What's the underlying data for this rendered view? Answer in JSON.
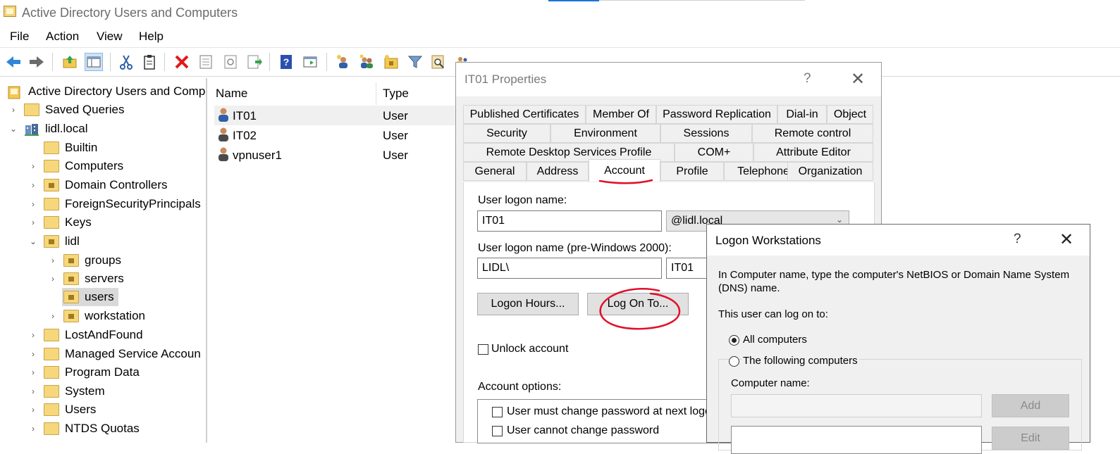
{
  "window": {
    "title": "Active Directory Users and Computers"
  },
  "menu": [
    "File",
    "Action",
    "View",
    "Help"
  ],
  "toolbar": {
    "icons": [
      "back-arrow-icon",
      "forward-arrow-icon",
      "up-folder-icon",
      "console-tree-icon",
      "cut-icon",
      "clipboard-icon",
      "delete-icon",
      "properties-icon",
      "refresh-icon",
      "export-list-icon",
      "help-icon",
      "action-pane-icon",
      "new-user-icon",
      "new-group-icon",
      "new-ou-icon",
      "filter-icon",
      "find-icon",
      "add-to-group-icon"
    ]
  },
  "tree": {
    "root": "Active Directory Users and Comp",
    "items": [
      {
        "label": "Saved Queries"
      },
      {
        "label": "lidl.local"
      },
      {
        "label": "Builtin"
      },
      {
        "label": "Computers"
      },
      {
        "label": "Domain Controllers"
      },
      {
        "label": "ForeignSecurityPrincipals"
      },
      {
        "label": "Keys"
      },
      {
        "label": "lidl"
      },
      {
        "label": "groups"
      },
      {
        "label": "servers"
      },
      {
        "label": "users"
      },
      {
        "label": "workstation"
      },
      {
        "label": "LostAndFound"
      },
      {
        "label": "Managed Service Accoun"
      },
      {
        "label": "Program Data"
      },
      {
        "label": "System"
      },
      {
        "label": "Users"
      },
      {
        "label": "NTDS Quotas"
      }
    ]
  },
  "list": {
    "columns": [
      "Name",
      "Type"
    ],
    "rows": [
      {
        "name": "IT01",
        "type": "User"
      },
      {
        "name": "IT02",
        "type": "User"
      },
      {
        "name": "vpnuser1",
        "type": "User"
      }
    ]
  },
  "props": {
    "title": "IT01 Properties",
    "help": "?",
    "close": "✕",
    "tabs_row1": [
      "Published Certificates",
      "Member Of",
      "Password Replication",
      "Dial-in",
      "Object"
    ],
    "tabs_row2": [
      "Security",
      "Environment",
      "Sessions",
      "Remote control"
    ],
    "tabs_row3": [
      "Remote Desktop Services Profile",
      "COM+",
      "Attribute Editor"
    ],
    "tabs_row4": [
      "General",
      "Address",
      "Account",
      "Profile",
      "Telephones",
      "Organization"
    ],
    "logon_name_label": "User logon name:",
    "logon_name": "IT01",
    "domain_suffix": "@lidl.local",
    "pre2000_label": "User logon name (pre-Windows 2000):",
    "pre2000_domain": "LIDL\\",
    "pre2000_user": "IT01",
    "logon_hours_btn": "Logon Hours...",
    "log_on_to_btn": "Log On To...",
    "unlock_label": "Unlock account",
    "account_options_label": "Account options:",
    "options": [
      "User must change password at next logo",
      "User cannot change password"
    ]
  },
  "logon": {
    "title": "Logon Workstations",
    "help": "?",
    "close": "✕",
    "instructions": "In Computer name, type the computer's NetBIOS or Domain Name System (DNS) name.",
    "can_log_on": "This user can log on to:",
    "radio_all": "All computers",
    "radio_following": "The following computers",
    "selected": "All computers",
    "computer_name_label": "Computer name:",
    "add_btn": "Add",
    "edit_btn": "Edit"
  },
  "colors": {
    "annotation": "#e0102a",
    "accent": "#1a73d8"
  }
}
